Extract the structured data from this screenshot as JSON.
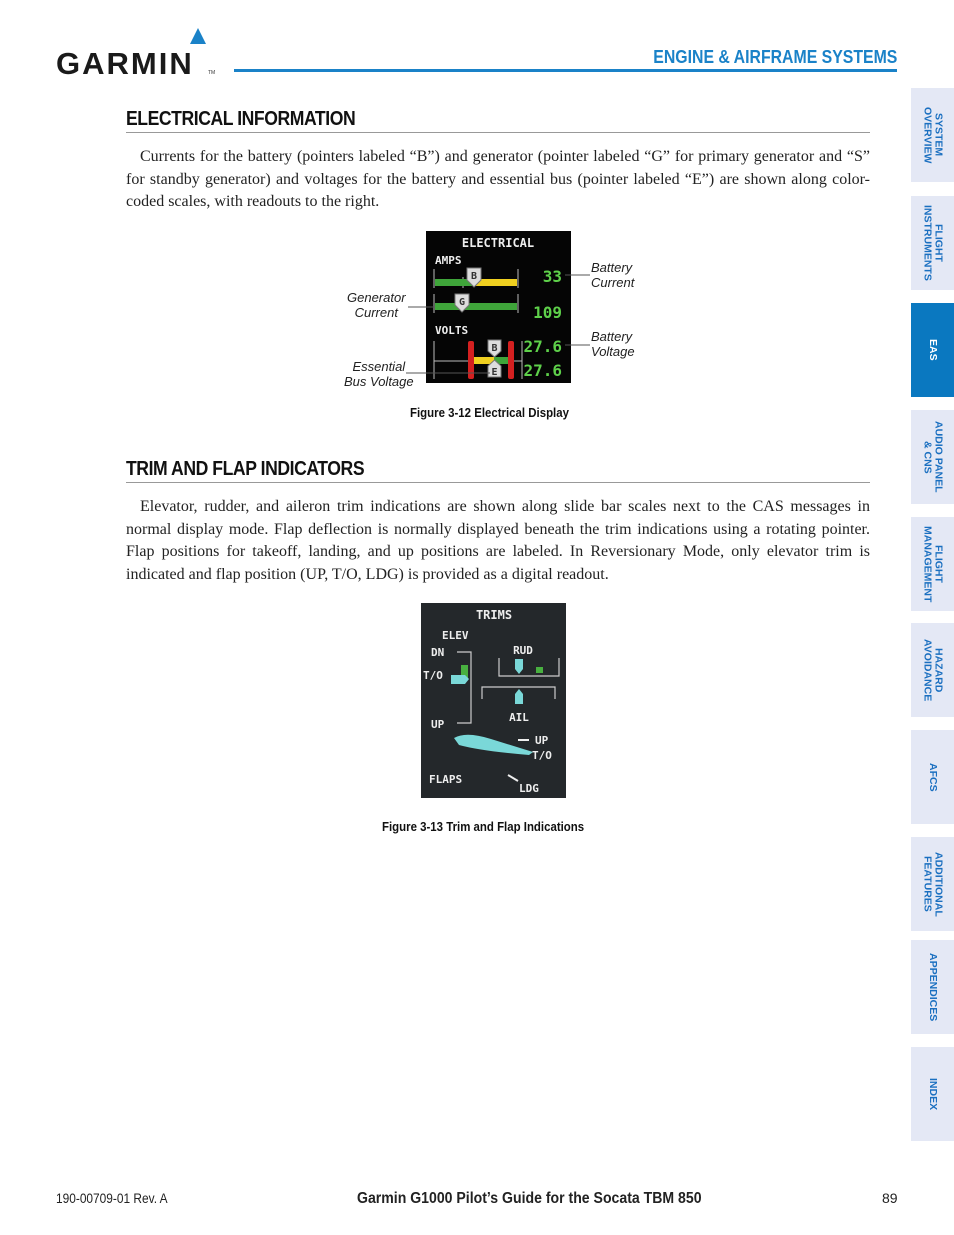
{
  "header": {
    "logo_text": "GARMIN",
    "logo_tm": "TM",
    "section_title": "ENGINE & AIRFRAME SYSTEMS",
    "accent_color": "#1a82c8"
  },
  "sections": [
    {
      "title": "ELECTRICAL INFORMATION",
      "body": "Currents for the battery (pointers labeled “B”) and generator (pointer labeled “G” for primary generator and “S” for standby generator) and voltages for the battery and essential bus (pointer labeled “E”) are shown along color-coded scales, with readouts to the right."
    },
    {
      "title": "TRIM AND FLAP INDICATORS",
      "body": "Elevator, rudder, and aileron trim indications are shown along slide bar scales next to the CAS messages in normal display mode.  Flap deflection is normally displayed beneath the trim indications using a rotating pointer.  Flap positions for takeoff, landing, and up positions are labeled.  In Reversionary Mode, only elevator trim is indicated and flap position (UP, T/O, LDG) is provided as a digital readout."
    }
  ],
  "figure_electrical": {
    "caption": "Figure 3-12  Electrical Display",
    "display": {
      "title": "ELECTRICAL",
      "amps_label": "AMPS",
      "volts_label": "VOLTS",
      "battery_pointer": "B",
      "generator_pointer": "G",
      "ess_pointer": "E",
      "battery_current": "33",
      "generator_current": "109",
      "battery_voltage": "27.6",
      "ess_bus_voltage": "27.6"
    },
    "callouts": {
      "battery_current": "Battery\nCurrent",
      "generator_current": "Generator\nCurrent",
      "battery_voltage": "Battery\nVoltage",
      "ess_bus_voltage": "Essential\nBus Voltage"
    }
  },
  "figure_trims": {
    "caption": "Figure 3-13  Trim and Flap Indications",
    "display": {
      "title": "TRIMS",
      "elev_label": "ELEV",
      "dn_label": "DN",
      "to_label": "T/O",
      "up_label": "UP",
      "rud_label": "RUD",
      "ail_label": "AIL",
      "flaps_label": "FLAPS",
      "flap_up": "UP",
      "flap_to": "T/O",
      "flap_ldg": "LDG"
    }
  },
  "side_tabs": [
    {
      "label": "SYSTEM\nOVERVIEW",
      "active": false
    },
    {
      "label": "FLIGHT\nINSTRUMENTS",
      "active": false
    },
    {
      "label": "EAS",
      "active": true
    },
    {
      "label": "AUDIO PANEL\n& CNS",
      "active": false
    },
    {
      "label": "FLIGHT\nMANAGEMENT",
      "active": false
    },
    {
      "label": "HAZARD\nAVOIDANCE",
      "active": false
    },
    {
      "label": "AFCS",
      "active": false
    },
    {
      "label": "ADDITIONAL\nFEATURES",
      "active": false
    },
    {
      "label": "APPENDICES",
      "active": false
    },
    {
      "label": "INDEX",
      "active": false
    }
  ],
  "footer": {
    "doc_number": "190-00709-01  Rev. A",
    "title": "Garmin G1000 Pilot’s Guide for the Socata TBM 850",
    "page": "89"
  }
}
